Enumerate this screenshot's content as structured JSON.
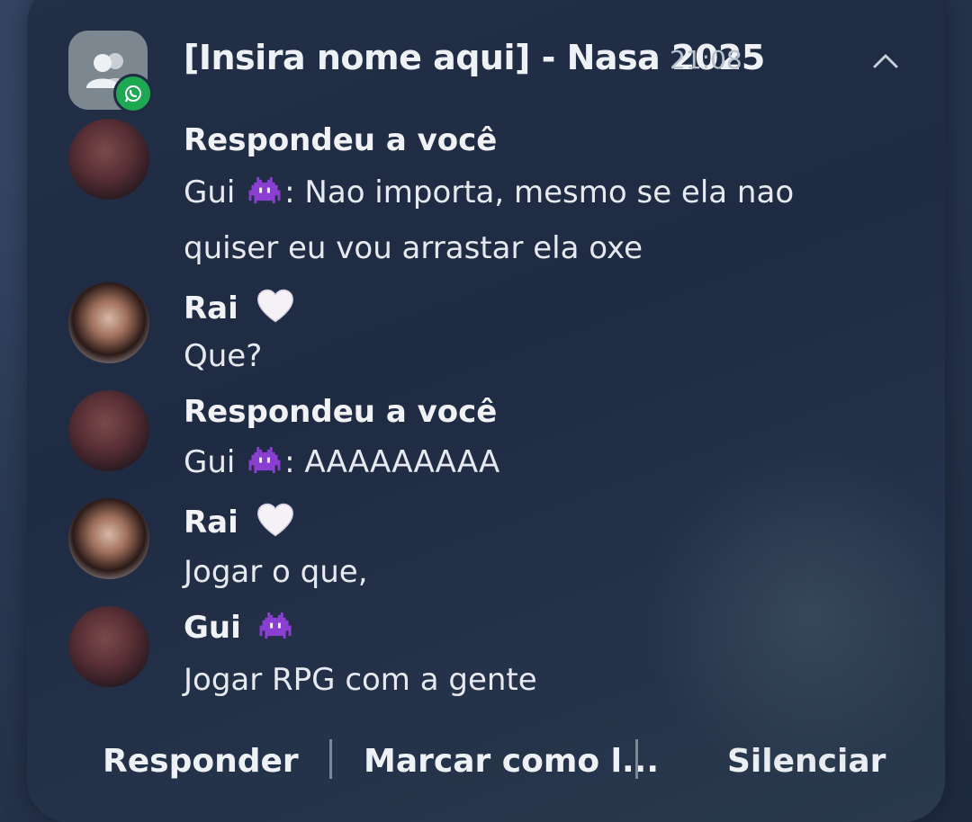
{
  "notification": {
    "app": "WhatsApp",
    "title": "[Insira nome aqui] - Nasa 2025",
    "time": "21:08",
    "collapse_icon": "chevron-up-icon",
    "group_icon": "group-icon"
  },
  "messages": [
    {
      "sender": "Respondeu a você",
      "avatar": "avatar-gui",
      "lines": [
        "Gui",
        ": Nao importa, mesmo se ela nao",
        "quiser eu vou arrastar ela oxe"
      ],
      "emoji": "alien-monster-emoji"
    },
    {
      "sender": "Rai",
      "sender_emoji": "white-heart-emoji",
      "avatar": "avatar-rai",
      "lines": [
        "Que?"
      ]
    },
    {
      "sender": "Respondeu a você",
      "avatar": "avatar-gui",
      "lines": [
        "Gui",
        ": AAAAAAAAA"
      ],
      "emoji": "alien-monster-emoji"
    },
    {
      "sender": "Rai",
      "sender_emoji": "white-heart-emoji",
      "avatar": "avatar-rai",
      "lines": [
        "Jogar o que,"
      ]
    },
    {
      "sender": "Gui",
      "sender_emoji": "alien-monster-emoji",
      "avatar": "avatar-gui",
      "lines": [
        "Jogar RPG com a gente"
      ]
    }
  ],
  "actions": {
    "reply": "Responder",
    "mark_read": "Marcar como l...",
    "mute": "Silenciar"
  },
  "colors": {
    "whatsapp_green": "#1da851",
    "invader_purple": "#8a3fd1"
  }
}
